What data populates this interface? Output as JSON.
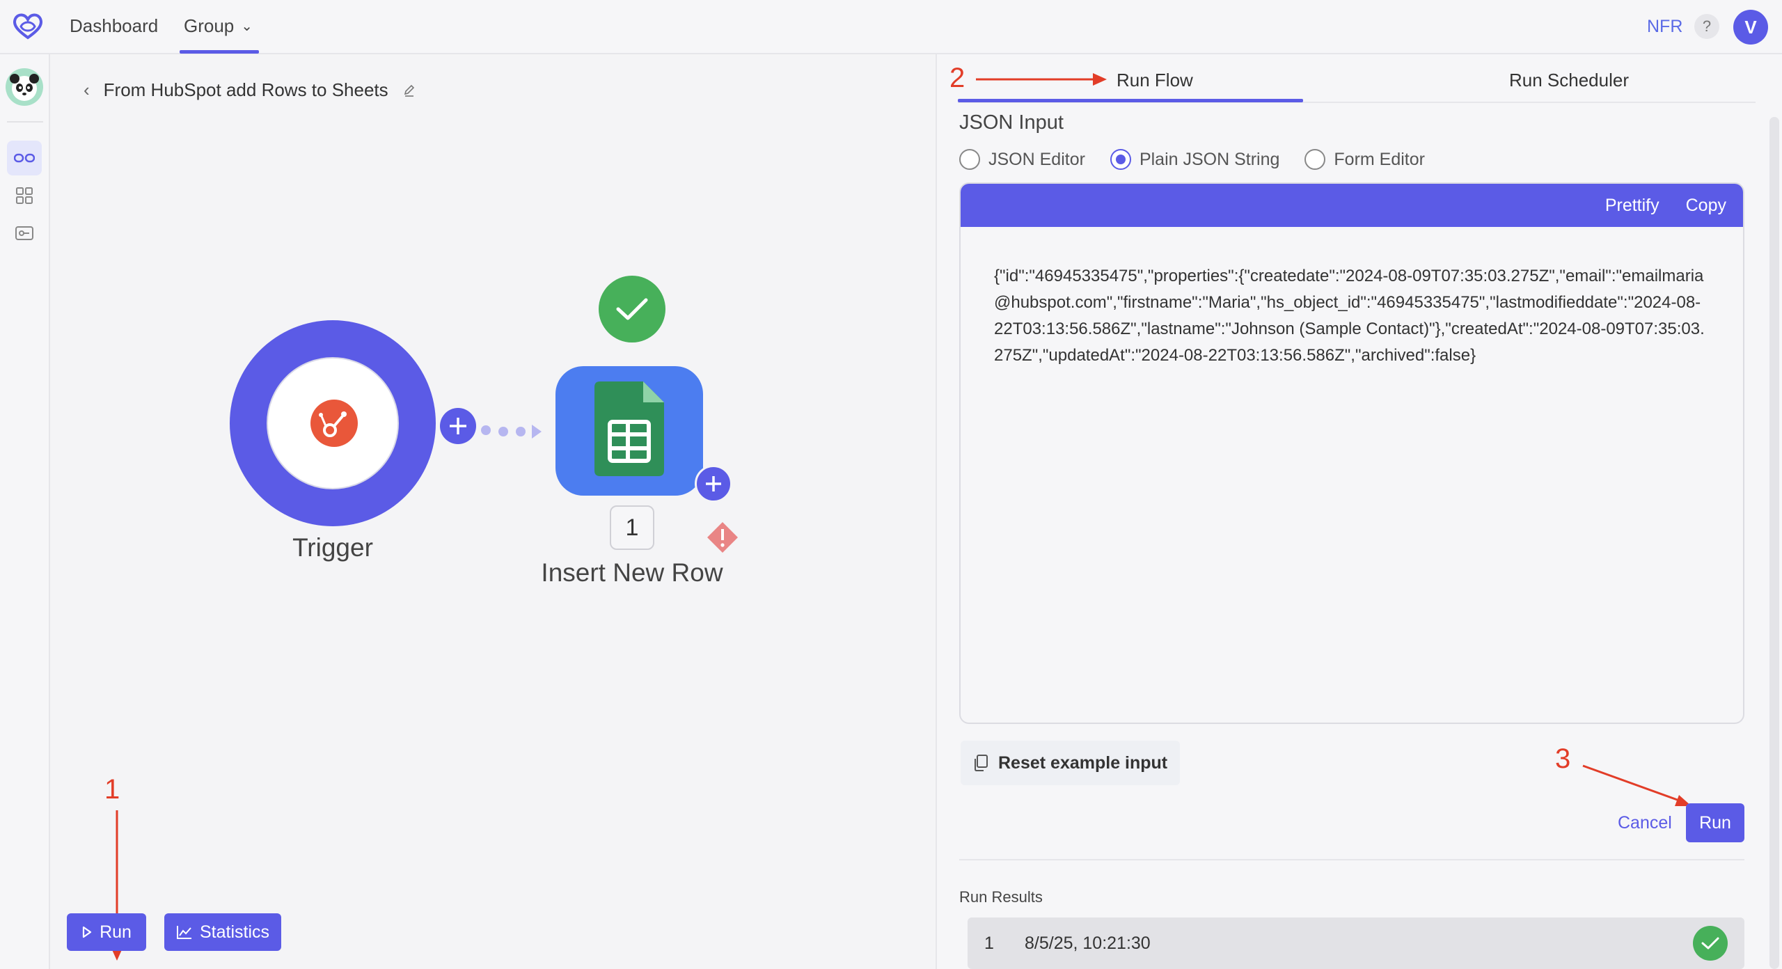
{
  "header": {
    "nav": {
      "dashboard": "Dashboard",
      "group": "Group"
    },
    "nfr": "NFR",
    "help": "?",
    "user_initial": "V"
  },
  "flow": {
    "title": "From HubSpot add Rows to Sheets",
    "trigger_label": "Trigger",
    "step_number": "1",
    "step_label": "Insert New Row"
  },
  "canvas_buttons": {
    "run": "Run",
    "statistics": "Statistics"
  },
  "panel": {
    "tabs": {
      "run_flow": "Run Flow",
      "run_scheduler": "Run Scheduler"
    },
    "section_title": "JSON Input",
    "input_modes": [
      "JSON Editor",
      "Plain JSON String",
      "Form Editor"
    ],
    "selected_mode": "Plain JSON String",
    "editor_actions": {
      "prettify": "Prettify",
      "copy": "Copy"
    },
    "json_text": "{\"id\":\"46945335475\",\"properties\":{\"createdate\":\"2024-08-09T07:35:03.275Z\",\"email\":\"emailmaria@hubspot.com\",\"firstname\":\"Maria\",\"hs_object_id\":\"46945335475\",\"lastmodifieddate\":\"2024-08-22T03:13:56.586Z\",\"lastname\":\"Johnson (Sample Contact)\"},\"createdAt\":\"2024-08-09T07:35:03.275Z\",\"updatedAt\":\"2024-08-22T03:13:56.586Z\",\"archived\":false}",
    "reset_label": "Reset example input",
    "cancel_label": "Cancel",
    "run_label": "Run",
    "results_title": "Run Results",
    "results": [
      {
        "index": "1",
        "timestamp": "8/5/25, 10:21:30",
        "status": "success"
      }
    ]
  },
  "annotations": {
    "one": "1",
    "two": "2",
    "three": "3"
  },
  "colors": {
    "accent": "#5b5be6",
    "success": "#47b05a",
    "warning": "#e98585",
    "hubspot": "#e9573a",
    "sheets": "#2f8f58",
    "annotation": "#e23d28"
  }
}
